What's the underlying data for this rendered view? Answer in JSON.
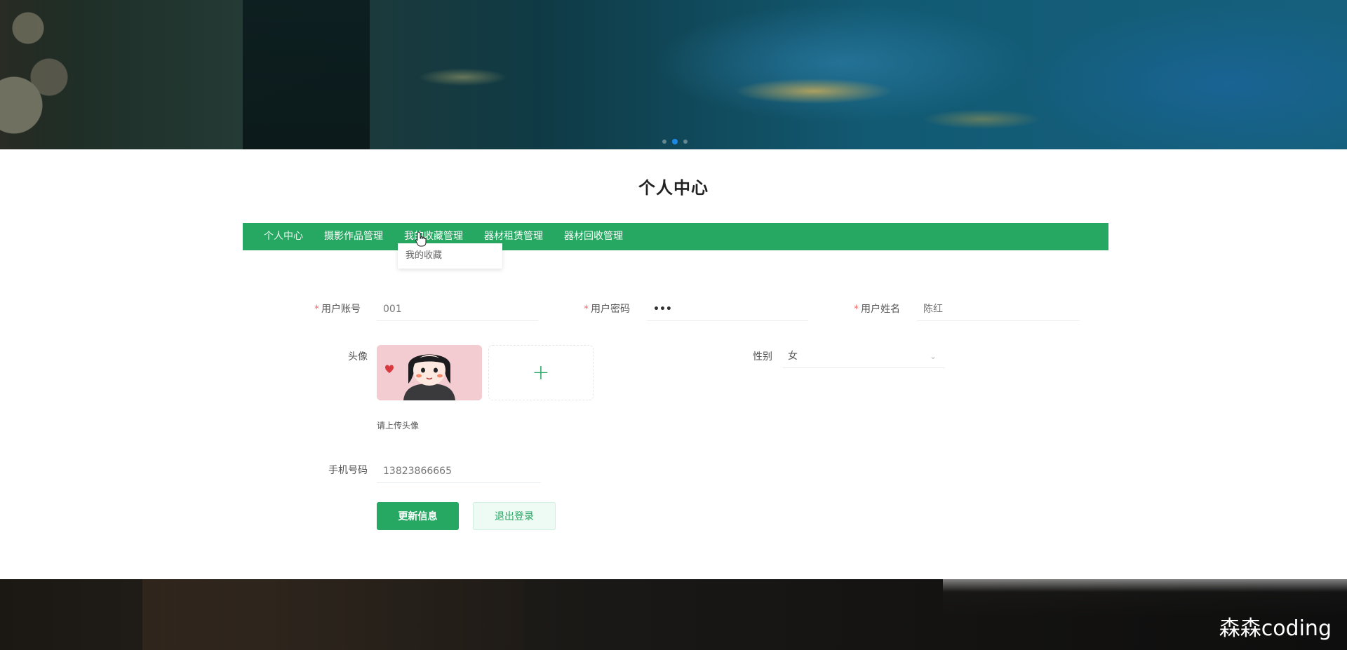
{
  "banner": {
    "carousel_dots": 3,
    "active_dot": 2
  },
  "page_title": "个人中心",
  "nav": {
    "items": [
      "个人中心",
      "摄影作品管理",
      "我的收藏管理",
      "器材租赁管理",
      "器材回收管理"
    ],
    "dropdown_item": "我的收藏"
  },
  "form": {
    "username": {
      "label": "用户账号",
      "value": "001"
    },
    "password": {
      "label": "用户密码",
      "value": "•••"
    },
    "realname": {
      "label": "用户姓名",
      "value": "陈红"
    },
    "avatar": {
      "label": "头像",
      "hint": "请上传头像",
      "upload_icon": "+"
    },
    "gender": {
      "label": "性别",
      "value": "女"
    },
    "phone": {
      "label": "手机号码",
      "value": "13823866665"
    },
    "required_mark": "*"
  },
  "buttons": {
    "update": "更新信息",
    "logout": "退出登录"
  },
  "watermark": "森森coding",
  "colors": {
    "accent": "#27a862",
    "required": "#f56c6c",
    "active_dot": "#1e88e5"
  }
}
